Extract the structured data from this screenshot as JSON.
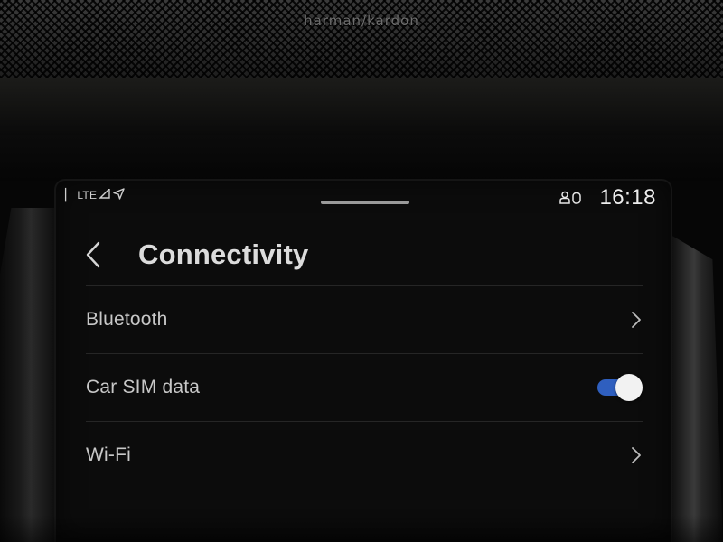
{
  "dashboard": {
    "brand": "harman/kardon"
  },
  "statusbar": {
    "network": "LTE",
    "signal_icon": "signal-icon",
    "location_icon": "location-arrow-icon",
    "user_icon": "user-profile-icon",
    "time": "16:18"
  },
  "header": {
    "back_icon": "chevron-left-icon",
    "title": "Connectivity"
  },
  "settings": {
    "items": [
      {
        "label": "Bluetooth",
        "control": "chevron"
      },
      {
        "label": "Car SIM data",
        "control": "toggle",
        "enabled": true
      },
      {
        "label": "Wi-Fi",
        "control": "chevron"
      }
    ]
  },
  "colors": {
    "screen_bg": "#0c0c0c",
    "text_primary": "#dcdcdc",
    "text_secondary": "#c8c8c8",
    "toggle_on": "#2f5fbf",
    "toggle_knob": "#f2f2f2",
    "divider": "#262626"
  }
}
